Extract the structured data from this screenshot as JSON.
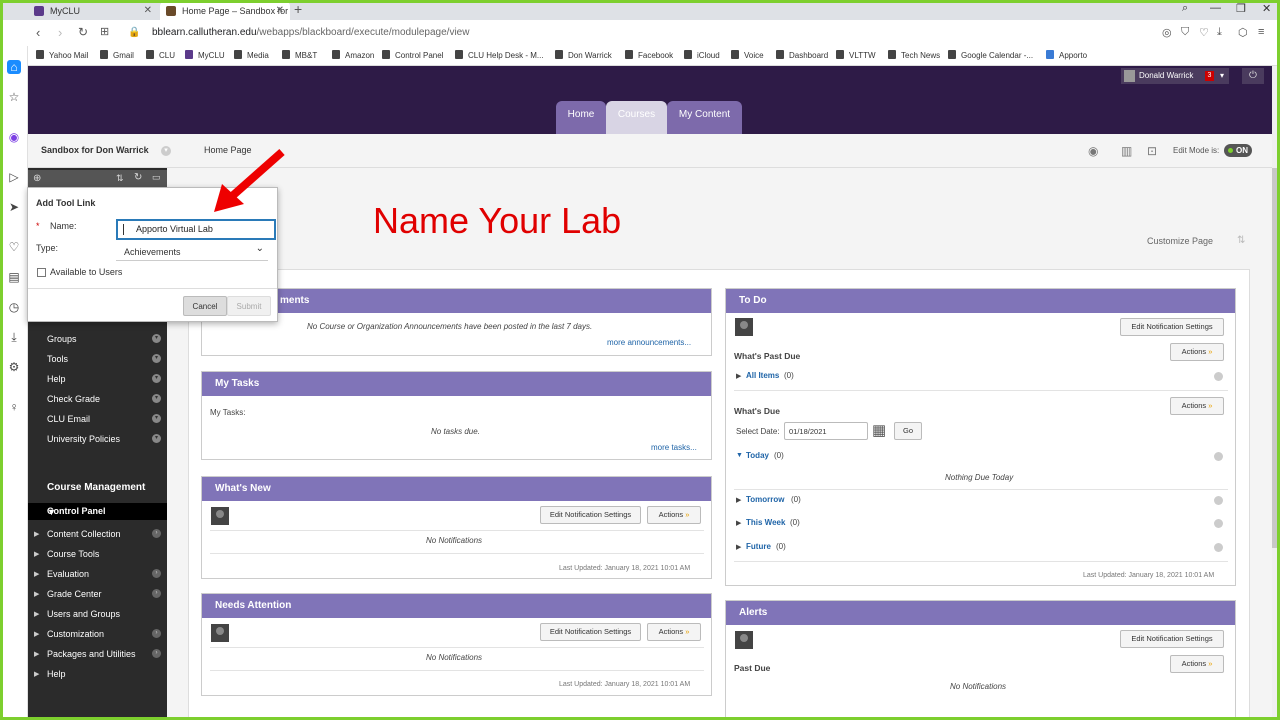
{
  "browser": {
    "tabs": [
      {
        "title": "MyCLU"
      },
      {
        "title": "Home Page – Sandbox for"
      }
    ],
    "url_domain": "bblearn.callutheran.edu",
    "url_path": "/webapps/blackboard/execute/modulepage/view",
    "bookmarks": [
      "Yahoo Mail",
      "Gmail",
      "CLU",
      "MyCLU",
      "Media",
      "MB&T",
      "Amazon",
      "Control Panel",
      "CLU Help Desk - M...",
      "Don Warrick",
      "Facebook",
      "iCloud",
      "Voice",
      "Dashboard",
      "VLTTW",
      "Tech News",
      "Google Calendar -...",
      "Apporto"
    ]
  },
  "header": {
    "user_name": "Donald Warrick",
    "notification_count": "3",
    "tabs": [
      "Home",
      "Courses",
      "My Content"
    ]
  },
  "crumbbar": {
    "course": "Sandbox for Don Warrick",
    "page": "Home Page",
    "edit_mode_label": "Edit Mode is:",
    "edit_mode_value": "ON"
  },
  "modal": {
    "title": "Add Tool Link",
    "required_mark": "*",
    "name_label": "Name:",
    "name_value": "Apporto Virtual Lab",
    "type_label": "Type:",
    "type_value": "Achievements",
    "available_label": "Available to Users",
    "cancel": "Cancel",
    "submit": "Submit"
  },
  "annotation": {
    "title": "Name Your Lab"
  },
  "left_menu": {
    "items": [
      "Groups",
      "Tools",
      "Help",
      "Check Grade",
      "CLU Email",
      "University Policies"
    ],
    "management_title": "Course Management",
    "control_panel": "Control Panel",
    "cp_items": [
      "Content Collection",
      "Course Tools",
      "Evaluation",
      "Grade Center",
      "Users and Groups",
      "Customization",
      "Packages and Utilities",
      "Help"
    ]
  },
  "customize": "Customize Page",
  "announcements": {
    "title_fragment": "ments",
    "empty": "No Course or Organization Announcements have been posted in the last 7 days.",
    "more": "more announcements..."
  },
  "tasks": {
    "title": "My Tasks",
    "label": "My Tasks:",
    "empty": "No tasks due.",
    "more": "more tasks..."
  },
  "whats_new": {
    "title": "What's New",
    "edit": "Edit Notification Settings",
    "actions": "Actions",
    "empty": "No Notifications",
    "updated": "Last Updated: January 18, 2021 10:01 AM"
  },
  "needs_attention": {
    "title": "Needs Attention",
    "edit": "Edit Notification Settings",
    "actions": "Actions",
    "empty": "No Notifications",
    "updated": "Last Updated: January 18, 2021 10:01 AM"
  },
  "todo": {
    "title": "To Do",
    "edit": "Edit Notification Settings",
    "past_due": "What's Past Due",
    "actions": "Actions",
    "all_items": "All Items",
    "all_items_count": "(0)",
    "whats_due": "What's Due",
    "select_date": "Select Date:",
    "date_value": "01/18/2021",
    "go": "Go",
    "today": "Today",
    "today_count": "(0)",
    "nothing_due": "Nothing Due Today",
    "tomorrow": "Tomorrow",
    "tomorrow_count": "(0)",
    "this_week": "This Week",
    "this_week_count": "(0)",
    "future": "Future",
    "future_count": "(0)",
    "updated": "Last Updated: January 18, 2021 10:01 AM"
  },
  "alerts": {
    "title": "Alerts",
    "edit": "Edit Notification Settings",
    "past_due": "Past Due",
    "actions": "Actions",
    "empty": "No Notifications"
  }
}
